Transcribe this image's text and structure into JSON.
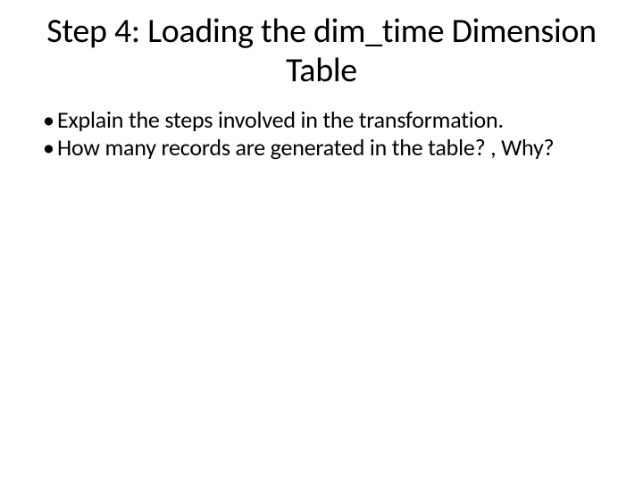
{
  "slide": {
    "title": "Step 4: Loading the dim_time Dimension Table",
    "bullets": [
      "Explain the steps involved in the transformation.",
      "How many records are generated in the table? , Why?"
    ]
  }
}
